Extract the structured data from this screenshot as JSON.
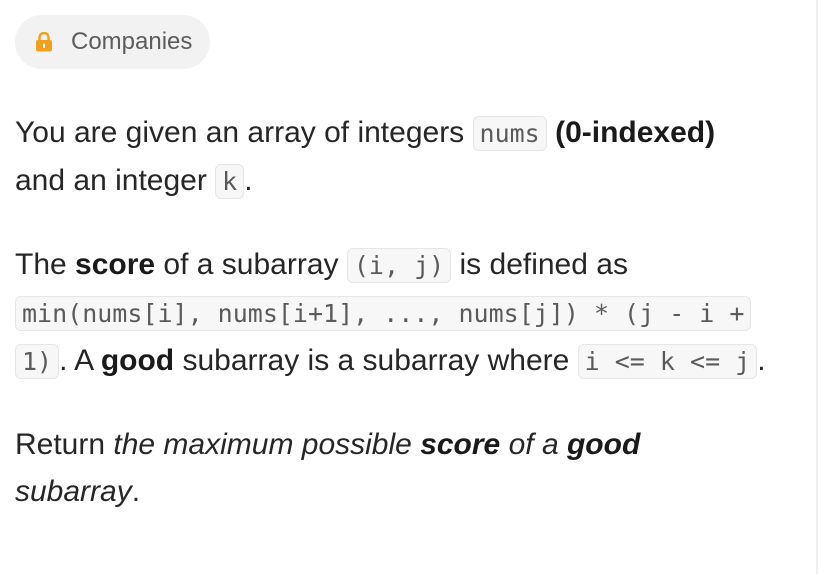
{
  "companies_chip": {
    "icon": "lock-icon",
    "icon_color": "#f0a01f",
    "label": "Companies"
  },
  "description": {
    "p1": {
      "text1": "You are given an array of integers ",
      "code1": "nums",
      "bold1": "(0-indexed)",
      "text2": "and an integer ",
      "code2": "k",
      "text3": "."
    },
    "p2": {
      "text1": "The ",
      "bold1": "score",
      "text2": " of a subarray ",
      "code1": "(i, j)",
      "text3": " is defined as ",
      "code2": "min(nums[i], nums[i+1], ..., nums[j]) * (j - i + 1)",
      "text4": ". A ",
      "bold2": "good",
      "text5": " subarray is a subarray where ",
      "code3": "i <= k <= j",
      "text6": "."
    },
    "p3": {
      "text1": "Return ",
      "italic1": "the maximum possible ",
      "bold1": "score",
      "italic2": " of a ",
      "bold2": "good",
      "italic3": "subarray",
      "text2": "."
    }
  }
}
